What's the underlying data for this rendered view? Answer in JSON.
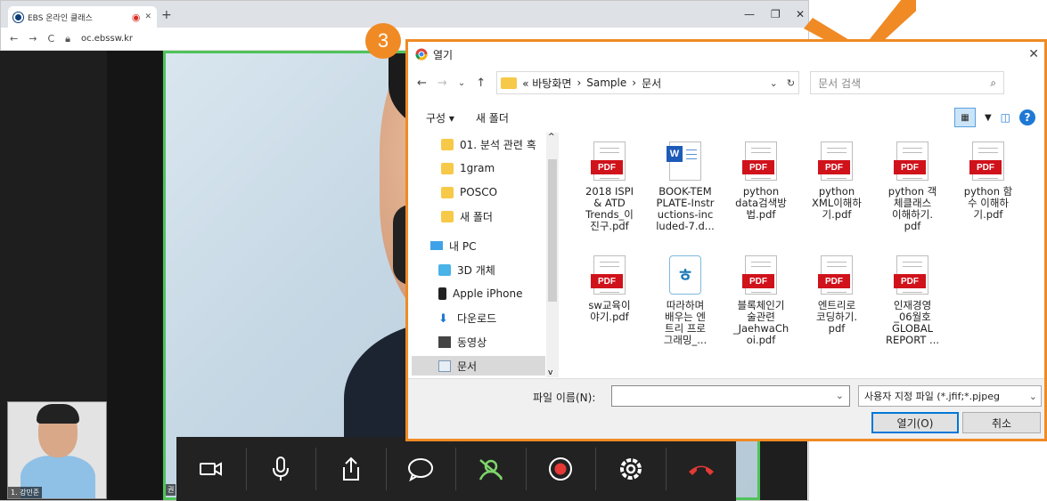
{
  "browser": {
    "tab_title": "EBS 온라인 클래스",
    "new_tab": "+",
    "url": "oc.ebssw.kr",
    "minimize": "—",
    "restore": "❐",
    "close": "✕"
  },
  "video": {
    "thumb_label": "1. 강민준",
    "main_label": "권"
  },
  "badge": "3",
  "dialog": {
    "title": "열기",
    "path": [
      "« 바탕화면",
      "Sample",
      "문서"
    ],
    "search_placeholder": "문서 검색",
    "organize": "구성 ▾",
    "new_folder": "새 폴더",
    "nav_items": [
      {
        "label": "01. 분석 관련 혹",
        "type": "folder"
      },
      {
        "label": "1gram",
        "type": "folder"
      },
      {
        "label": "POSCO",
        "type": "folder"
      },
      {
        "label": "새 폴더",
        "type": "folder"
      },
      {
        "label": "내 PC",
        "type": "pc"
      },
      {
        "label": "3D 개체",
        "type": "3d"
      },
      {
        "label": "Apple iPhone",
        "type": "phone"
      },
      {
        "label": "다운로드",
        "type": "download"
      },
      {
        "label": "동영상",
        "type": "video"
      },
      {
        "label": "문서",
        "type": "doc"
      }
    ],
    "files": [
      {
        "name": "2018 ISPI & ATD Trends_이진구.pdf",
        "lines": [
          "2018 ISPI",
          "& ATD",
          "Trends_이",
          "진구.pdf"
        ],
        "type": "pdf"
      },
      {
        "name": "BOOK-TEMPLATE-Instructions-included-7.d...",
        "lines": [
          "BOOK-TEM",
          "PLATE-Instr",
          "uctions-inc",
          "luded-7.d..."
        ],
        "type": "word"
      },
      {
        "name": "python data검색방법.pdf",
        "lines": [
          "python",
          "data검색방",
          "법.pdf"
        ],
        "type": "pdf"
      },
      {
        "name": "python XML이해하기.pdf",
        "lines": [
          "python",
          "XML이해하",
          "기.pdf"
        ],
        "type": "pdf"
      },
      {
        "name": "python 객체클래스 이해하기.pdf",
        "lines": [
          "python 객",
          "체클래스",
          "이해하기.",
          "pdf"
        ],
        "type": "pdf"
      },
      {
        "name": "python 함수 이해하기.pdf",
        "lines": [
          "python 함",
          "수 이해하",
          "기.pdf"
        ],
        "type": "pdf"
      },
      {
        "name": "sw교육이야기.pdf",
        "lines": [
          "sw교육이",
          "야기.pdf"
        ],
        "type": "pdf"
      },
      {
        "name": "따라하며 배우는 엔트리 프로그래밍_...",
        "lines": [
          "따라하며",
          "배우는 엔",
          "트리 프로",
          "그래밍_..."
        ],
        "type": "entry"
      },
      {
        "name": "블록체인기술관련_JaehwaChoi.pdf",
        "lines": [
          "블록체인기",
          "술관련",
          "_JaehwaCh",
          "oi.pdf"
        ],
        "type": "pdf"
      },
      {
        "name": "엔트리로 코딩하기.pdf",
        "lines": [
          "엔트리로",
          "코딩하기.",
          "pdf"
        ],
        "type": "pdf"
      },
      {
        "name": "인재경영_06월호 GLOBAL REPORT ...",
        "lines": [
          "인재경영",
          "_06월호",
          "GLOBAL",
          "REPORT ..."
        ],
        "type": "pdf"
      }
    ],
    "filename_label": "파일 이름(N):",
    "filename_value": "",
    "filetype": "사용자 지정 파일 (*.jfif;*.pjpeg",
    "open_button": "열기(O)",
    "cancel_button": "취소",
    "pdf_badge": "PDF",
    "word_badge": "W",
    "entry_badge": "ㅎ"
  },
  "toolbar": [
    "camera-icon",
    "mic-icon",
    "share-icon",
    "chat-icon",
    "participants-icon",
    "record-icon",
    "settings-icon",
    "hangup-icon"
  ],
  "colors": {
    "accent": "#f08a24",
    "speaker_border": "#4fc35a",
    "pdf_red": "#d0121b",
    "hangup": "#e53935",
    "record": "#e53935"
  }
}
